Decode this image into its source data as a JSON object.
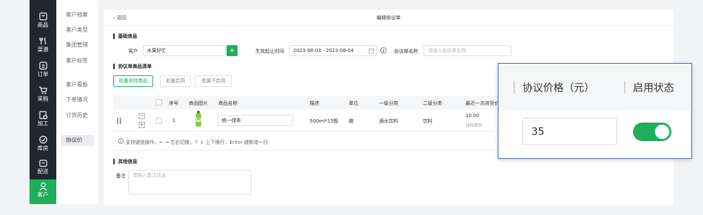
{
  "rail": [
    {
      "label": "商品",
      "icon": "goods-icon"
    },
    {
      "label": "菜谱",
      "icon": "utensils-icon"
    },
    {
      "label": "订单",
      "icon": "order-icon"
    },
    {
      "label": "采购",
      "icon": "cart-icon"
    },
    {
      "label": "加工",
      "icon": "process-icon"
    },
    {
      "label": "库房",
      "icon": "warehouse-icon"
    },
    {
      "label": "配送",
      "icon": "delivery-icon"
    },
    {
      "label": "客户",
      "icon": "customer-icon",
      "active": true
    }
  ],
  "subnav": {
    "items": [
      "客户档案",
      "客户类型",
      "集团管理",
      "客户标签",
      "客户看板",
      "下单情况",
      "订货历史",
      "协议价"
    ],
    "active": "协议价"
  },
  "topbar": {
    "back_label": "返回",
    "title": "编辑协议单"
  },
  "basic": {
    "section_title": "基础信息",
    "customer_label": "客户",
    "customer_value": "水果好忙",
    "period_label": "生效起止时间",
    "period_value": "2023-08-03 - 2023-08-04",
    "name_label": "协议单名称",
    "name_placeholder": "请输入协议单名称"
  },
  "goods": {
    "section_title": "协议单商品清单",
    "buttons": [
      "批量添加商品",
      "批量启用",
      "批量不启用"
    ],
    "columns": [
      "序号",
      "商品图片",
      "商品名称",
      "描述",
      "单位",
      "一级分类",
      "二级分类",
      "最近一次进货价"
    ],
    "row": {
      "index": "1",
      "name": "统一绿茶",
      "desc": "500ml*15瓶",
      "unit": "箱",
      "cat1": "酒水饮料",
      "cat2": "饮料",
      "last_price": "10.00",
      "last_price_sub": "谷粒商贸"
    },
    "hint": "支持键盘操作，← → 左右切换，↑ ↓ 上下换行，Enter 键新增一行"
  },
  "other": {
    "section_title": "其他信息",
    "remark_label": "备注",
    "remark_placeholder": "请输入备注信息"
  },
  "callout": {
    "price_header": "协议价格（元）",
    "status_header": "启用状态",
    "price_value": "35",
    "status_on": true
  },
  "colors": {
    "accent": "#1fae5b",
    "rail_bg": "#22262e",
    "callout_border": "#3a5fcd"
  }
}
